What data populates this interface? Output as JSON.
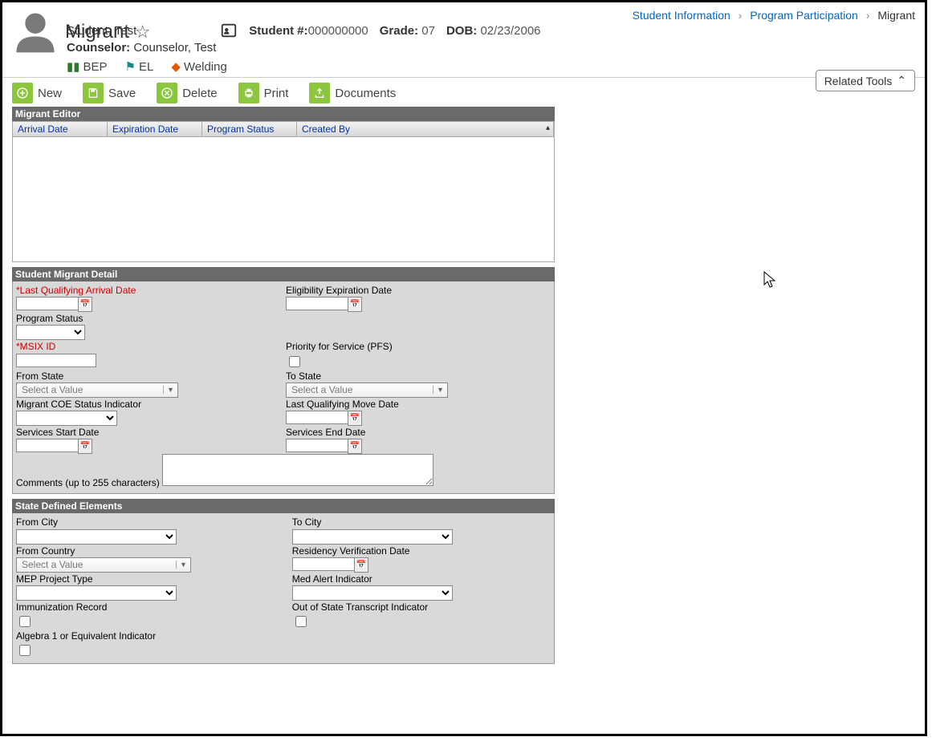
{
  "breadcrumb": {
    "student_info": "Student Information",
    "program_participation": "Program Participation",
    "migrant": "Migrant"
  },
  "header": {
    "title": "Migrant",
    "student_name": "Student, Test",
    "counselor_label": "Counselor:",
    "counselor_value": "Counselor, Test",
    "student_num_label": "Student #:",
    "student_num_value": "000000000",
    "grade_label": "Grade:",
    "grade_value": "07",
    "dob_label": "DOB:",
    "dob_value": "02/23/2006",
    "related_tools": "Related Tools"
  },
  "tags": {
    "bep": "BEP",
    "el": "EL",
    "welding": "Welding"
  },
  "toolbar": {
    "new": "New",
    "save": "Save",
    "delete": "Delete",
    "print": "Print",
    "documents": "Documents"
  },
  "editor": {
    "panel_title": "Migrant Editor",
    "cols": {
      "arrival": "Arrival Date",
      "expiration": "Expiration Date",
      "status": "Program Status",
      "created": "Created By"
    }
  },
  "detail": {
    "panel_title": "Student Migrant Detail",
    "last_qualifying_arrival": "Last Qualifying Arrival Date",
    "eligibility_expiration": "Eligibility Expiration Date",
    "program_status": "Program Status",
    "msix_id": "MSIX ID",
    "pfs": "Priority for Service (PFS)",
    "from_state": "From State",
    "to_state": "To State",
    "select_value": "Select a Value",
    "coe_status": "Migrant COE Status Indicator",
    "last_qualifying_move": "Last Qualifying Move Date",
    "services_start": "Services Start Date",
    "services_end": "Services End Date",
    "comments": "Comments (up to 255 characters)"
  },
  "state": {
    "panel_title": "State Defined Elements",
    "from_city": "From City",
    "to_city": "To City",
    "from_country": "From Country",
    "residency_verification": "Residency Verification Date",
    "mep_project": "MEP Project Type",
    "med_alert": "Med Alert Indicator",
    "immunization": "Immunization Record",
    "out_of_state_transcript": "Out of State Transcript Indicator",
    "algebra1": "Algebra 1 or Equivalent Indicator"
  }
}
